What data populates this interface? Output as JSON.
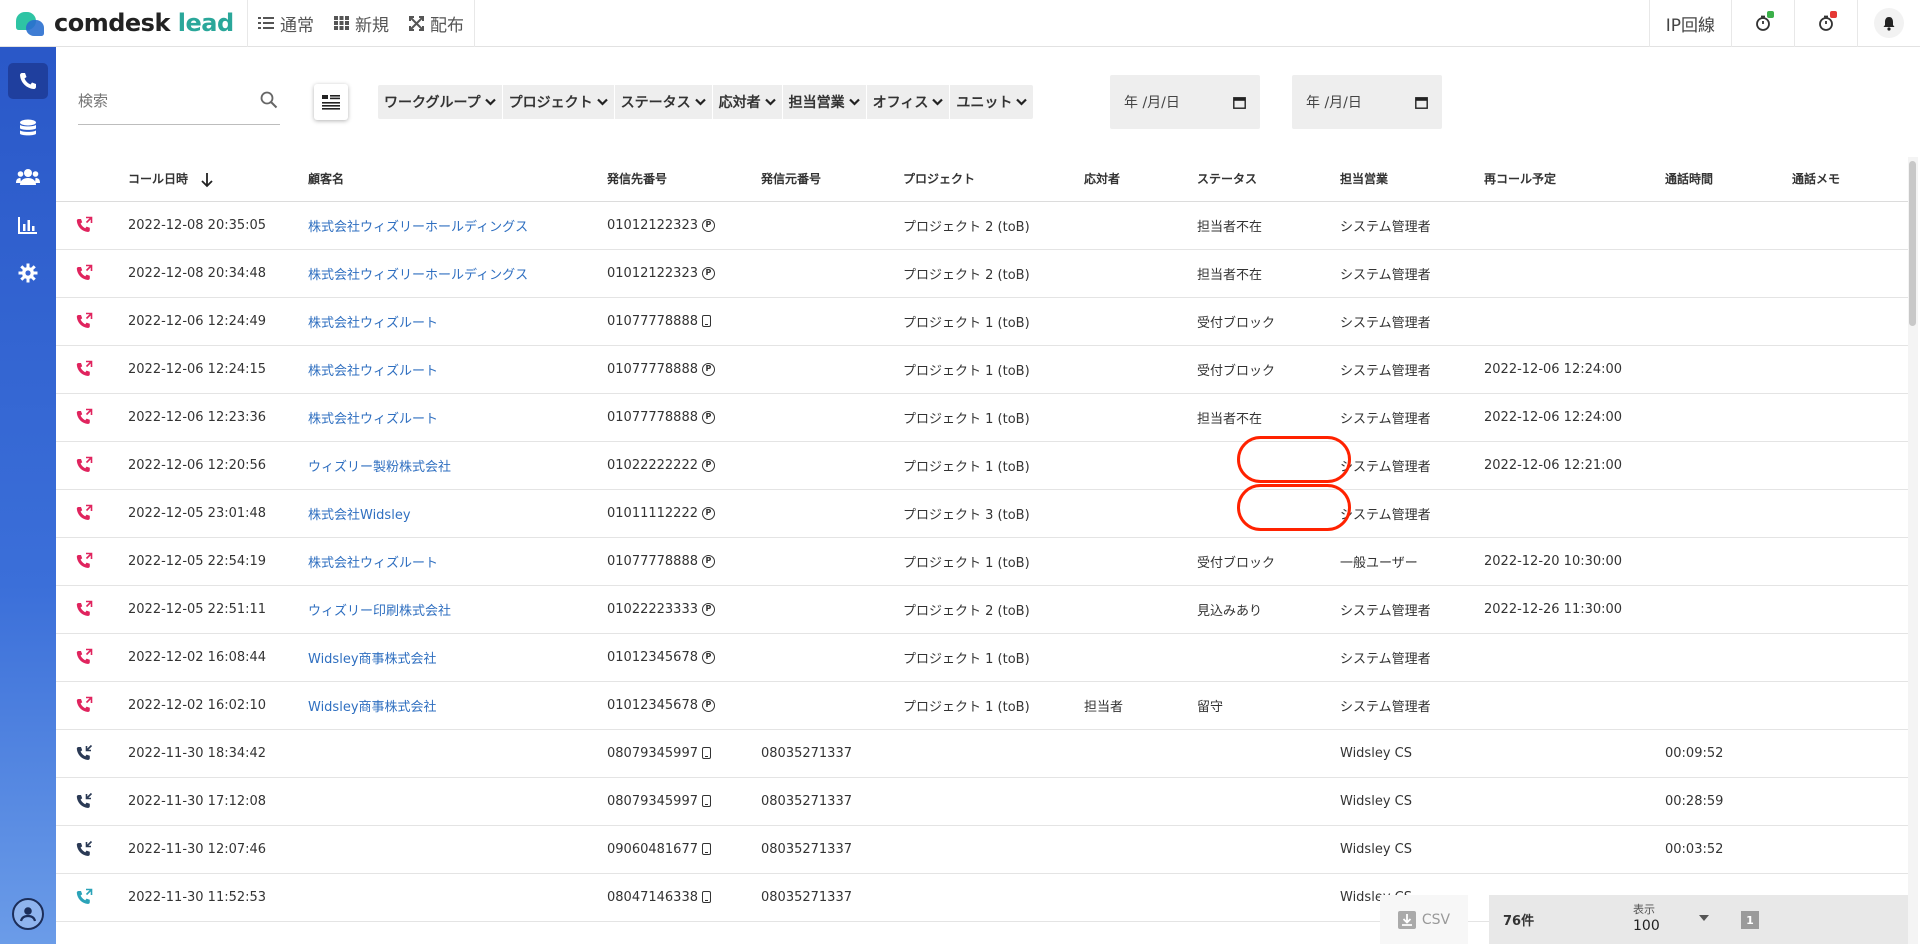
{
  "header": {
    "logo_main": "comdesk",
    "logo_sub": "lead",
    "nav": [
      {
        "label": "通常",
        "icon": "list-icon"
      },
      {
        "label": "新規",
        "icon": "grid-icon"
      },
      {
        "label": "配布",
        "icon": "distribute-icon"
      }
    ],
    "ip_line_label": "IP回線",
    "status_colors": {
      "green": "#3bb04a",
      "red": "#e53935"
    }
  },
  "sidebar": {
    "items": [
      {
        "name": "phone",
        "icon": "phone-icon",
        "active": true
      },
      {
        "name": "database",
        "icon": "database-icon",
        "active": false
      },
      {
        "name": "users",
        "icon": "users-icon",
        "active": false
      },
      {
        "name": "analytics",
        "icon": "bar-chart-icon",
        "active": false
      },
      {
        "name": "settings",
        "icon": "gear-icon",
        "active": false
      }
    ],
    "bottom_icon": "account-icon"
  },
  "filters": {
    "search_placeholder": "検索",
    "dropdowns": [
      "ワークグループ",
      "プロジェクト",
      "ステータス",
      "応対者",
      "担当営業",
      "オフィス",
      "ユニット"
    ],
    "date_from_placeholder": "年 /月/日",
    "date_to_placeholder": "年 /月/日"
  },
  "table": {
    "columns": [
      "コール日時",
      "顧客名",
      "発信先番号",
      "発信元番号",
      "プロジェクト",
      "応対者",
      "ステータス",
      "担当営業",
      "再コール予定",
      "通話時間",
      "通話メモ"
    ],
    "rows": [
      {
        "call_type": "outbound-missed",
        "datetime": "2022-12-08 20:35:05",
        "customer": "株式会社ウィズリーホールディングス",
        "to": "01012122323",
        "to_type": "P",
        "from": "",
        "project": "プロジェクト 2 (toB)",
        "responder": "",
        "status": "担当者不在",
        "sales": "システム管理者",
        "recall": "",
        "duration": "",
        "memo": ""
      },
      {
        "call_type": "outbound-missed",
        "datetime": "2022-12-08 20:34:48",
        "customer": "株式会社ウィズリーホールディングス",
        "to": "01012122323",
        "to_type": "P",
        "from": "",
        "project": "プロジェクト 2 (toB)",
        "responder": "",
        "status": "担当者不在",
        "sales": "システム管理者",
        "recall": "",
        "duration": "",
        "memo": ""
      },
      {
        "call_type": "outbound-missed",
        "datetime": "2022-12-06 12:24:49",
        "customer": "株式会社ウィズルート",
        "to": "01077778888",
        "to_type": "M",
        "from": "",
        "project": "プロジェクト 1 (toB)",
        "responder": "",
        "status": "受付ブロック",
        "sales": "システム管理者",
        "recall": "",
        "duration": "",
        "memo": ""
      },
      {
        "call_type": "outbound-missed",
        "datetime": "2022-12-06 12:24:15",
        "customer": "株式会社ウィズルート",
        "to": "01077778888",
        "to_type": "P",
        "from": "",
        "project": "プロジェクト 1 (toB)",
        "responder": "",
        "status": "受付ブロック",
        "sales": "システム管理者",
        "recall": "2022-12-06 12:24:00",
        "duration": "",
        "memo": ""
      },
      {
        "call_type": "outbound-missed",
        "datetime": "2022-12-06 12:23:36",
        "customer": "株式会社ウィズルート",
        "to": "01077778888",
        "to_type": "P",
        "from": "",
        "project": "プロジェクト 1 (toB)",
        "responder": "",
        "status": "担当者不在",
        "sales": "システム管理者",
        "recall": "2022-12-06 12:24:00",
        "duration": "",
        "memo": ""
      },
      {
        "call_type": "outbound-missed",
        "datetime": "2022-12-06 12:20:56",
        "customer": "ウィズリー製粉株式会社",
        "to": "01022222222",
        "to_type": "P",
        "from": "",
        "project": "プロジェクト 1 (toB)",
        "responder": "",
        "status": "",
        "sales": "システム管理者",
        "recall": "2022-12-06 12:21:00",
        "duration": "",
        "memo": ""
      },
      {
        "call_type": "outbound-missed",
        "datetime": "2022-12-05 23:01:48",
        "customer": "株式会社Widsley",
        "to": "01011112222",
        "to_type": "P",
        "from": "",
        "project": "プロジェクト 3 (toB)",
        "responder": "",
        "status": "",
        "sales": "システム管理者",
        "recall": "",
        "duration": "",
        "memo": ""
      },
      {
        "call_type": "outbound-missed",
        "datetime": "2022-12-05 22:54:19",
        "customer": "株式会社ウィズルート",
        "to": "01077778888",
        "to_type": "P",
        "from": "",
        "project": "プロジェクト 1 (toB)",
        "responder": "",
        "status": "受付ブロック",
        "sales": "一般ユーザー",
        "recall": "2022-12-20 10:30:00",
        "duration": "",
        "memo": ""
      },
      {
        "call_type": "outbound-missed",
        "datetime": "2022-12-05 22:51:11",
        "customer": "ウィズリー印刷株式会社",
        "to": "01022223333",
        "to_type": "P",
        "from": "",
        "project": "プロジェクト 2 (toB)",
        "responder": "",
        "status": "見込みあり",
        "sales": "システム管理者",
        "recall": "2022-12-26 11:30:00",
        "duration": "",
        "memo": ""
      },
      {
        "call_type": "outbound-missed",
        "datetime": "2022-12-02 16:08:44",
        "customer": "Widsley商事株式会社",
        "to": "01012345678",
        "to_type": "P",
        "from": "",
        "project": "プロジェクト 1 (toB)",
        "responder": "",
        "status": "",
        "sales": "システム管理者",
        "recall": "",
        "duration": "",
        "memo": ""
      },
      {
        "call_type": "outbound-missed",
        "datetime": "2022-12-02 16:02:10",
        "customer": "Widsley商事株式会社",
        "to": "01012345678",
        "to_type": "P",
        "from": "",
        "project": "プロジェクト 1 (toB)",
        "responder": "担当者",
        "status": "留守",
        "sales": "システム管理者",
        "recall": "",
        "duration": "",
        "memo": ""
      },
      {
        "call_type": "inbound",
        "datetime": "2022-11-30 18:34:42",
        "customer": "",
        "to": "08079345997",
        "to_type": "M",
        "from": "08035271337",
        "project": "",
        "responder": "",
        "status": "",
        "sales": "Widsley CS",
        "recall": "",
        "duration": "00:09:52",
        "memo": ""
      },
      {
        "call_type": "inbound",
        "datetime": "2022-11-30 17:12:08",
        "customer": "",
        "to": "08079345997",
        "to_type": "M",
        "from": "08035271337",
        "project": "",
        "responder": "",
        "status": "",
        "sales": "Widsley CS",
        "recall": "",
        "duration": "00:28:59",
        "memo": ""
      },
      {
        "call_type": "inbound",
        "datetime": "2022-11-30 12:07:46",
        "customer": "",
        "to": "09060481677",
        "to_type": "M",
        "from": "08035271337",
        "project": "",
        "responder": "",
        "status": "",
        "sales": "Widsley CS",
        "recall": "",
        "duration": "00:03:52",
        "memo": ""
      },
      {
        "call_type": "outbound-answered",
        "datetime": "2022-11-30 11:52:53",
        "customer": "",
        "to": "08047146338",
        "to_type": "M",
        "from": "08035271337",
        "project": "",
        "responder": "",
        "status": "",
        "sales": "Widsley CS",
        "recall": "",
        "duration": "",
        "memo": ""
      }
    ]
  },
  "footer": {
    "csv_label": "CSV",
    "count": "76件",
    "per_page_label": "表示",
    "per_page_value": "100",
    "page": "1"
  },
  "colors": {
    "accent": "#2f6fc0",
    "call_missed": "#e0245e",
    "call_inbound": "#2b3a55",
    "call_outbound": "#2ba3b8",
    "highlight": "#ff2200"
  }
}
